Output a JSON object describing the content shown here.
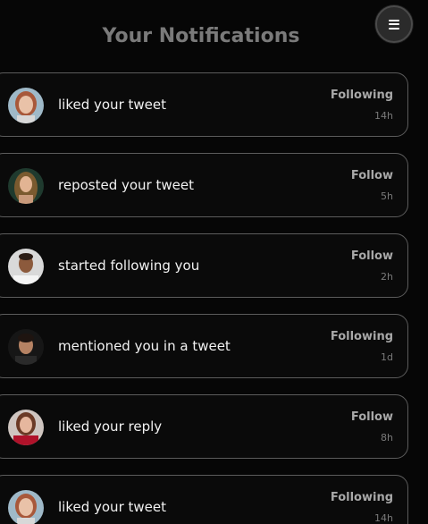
{
  "header": {
    "title": "Your Notifications",
    "menu_icon": "hamburger-menu-icon"
  },
  "notifications": [
    {
      "action": "liked your tweet",
      "follow_label": "Following",
      "time": "14h",
      "avatar": "avatar-woman-red-hair"
    },
    {
      "action": "reposted your tweet",
      "follow_label": "Follow",
      "time": "5h",
      "avatar": "avatar-woman-long-hair"
    },
    {
      "action": "started following you",
      "follow_label": "Follow",
      "time": "2h",
      "avatar": "avatar-man-smiling"
    },
    {
      "action": "mentioned you in a tweet",
      "follow_label": "Following",
      "time": "1d",
      "avatar": "avatar-man-dark"
    },
    {
      "action": "liked your reply",
      "follow_label": "Follow",
      "time": "8h",
      "avatar": "avatar-woman-red-top"
    },
    {
      "action": "liked your tweet",
      "follow_label": "Following",
      "time": "14h",
      "avatar": "avatar-woman-red-hair"
    }
  ]
}
